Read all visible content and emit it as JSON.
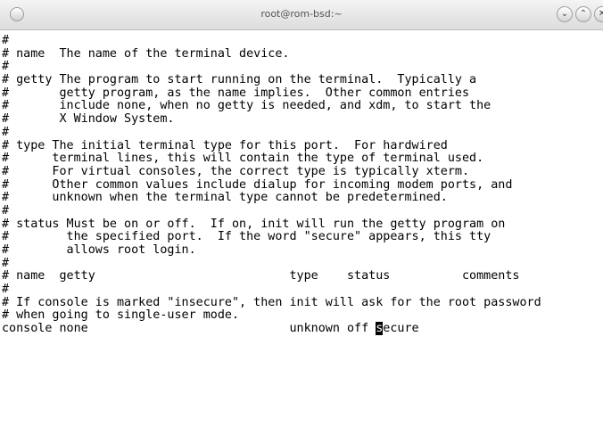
{
  "window": {
    "title": "root@rom-bsd:~",
    "controls": {
      "minimize_icon": "⌄",
      "maximize_icon": "⌃",
      "close_icon": "✕"
    }
  },
  "terminal": {
    "lines": [
      "#",
      "# name  The name of the terminal device.",
      "#",
      "# getty The program to start running on the terminal.  Typically a",
      "#       getty program, as the name implies.  Other common entries",
      "#       include none, when no getty is needed, and xdm, to start the",
      "#       X Window System.",
      "#",
      "# type The initial terminal type for this port.  For hardwired",
      "#      terminal lines, this will contain the type of terminal used.",
      "#      For virtual consoles, the correct type is typically xterm.",
      "#      Other common values include dialup for incoming modem ports, and",
      "#      unknown when the terminal type cannot be predetermined.",
      "#",
      "# status Must be on or off.  If on, init will run the getty program on",
      "#        the specified port.  If the word \"secure\" appears, this tty",
      "#        allows root login.",
      "#",
      "# name  getty                           type    status          comments",
      "#",
      "# If console is marked \"insecure\", then init will ask for the root password",
      "# when going to single-user mode."
    ],
    "last_line": {
      "before_cursor": "console none                            unknown off ",
      "cursor_char": "s",
      "after_cursor": "ecure"
    }
  }
}
